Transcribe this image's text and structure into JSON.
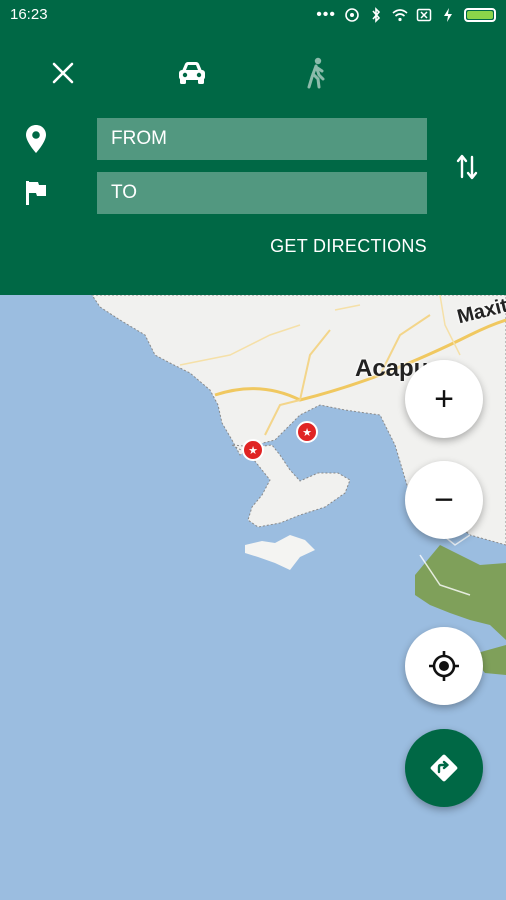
{
  "status_bar": {
    "time": "16:23",
    "battery_color": "#8bd44a"
  },
  "header": {
    "background": "#006845",
    "close_icon": "close-icon",
    "car_icon": "car-icon",
    "walk_icon": "walk-icon"
  },
  "route_form": {
    "from_placeholder": "FROM",
    "to_placeholder": "TO",
    "from_icon": "location-pin-icon",
    "to_icon": "flag-icon",
    "swap_icon": "swap-vertical-icon",
    "get_directions_label": "GET DIRECTIONS"
  },
  "map": {
    "city_label": "Acapu",
    "road_label": "Maxit",
    "water_color": "#9bbde0",
    "land_color": "#f1f1ef",
    "park_color": "#7fa05a",
    "poi_color": "#e02424"
  },
  "controls": {
    "zoom_in_label": "+",
    "zoom_out_label": "−",
    "locate_icon": "my-location-icon",
    "directions_icon": "directions-icon"
  }
}
